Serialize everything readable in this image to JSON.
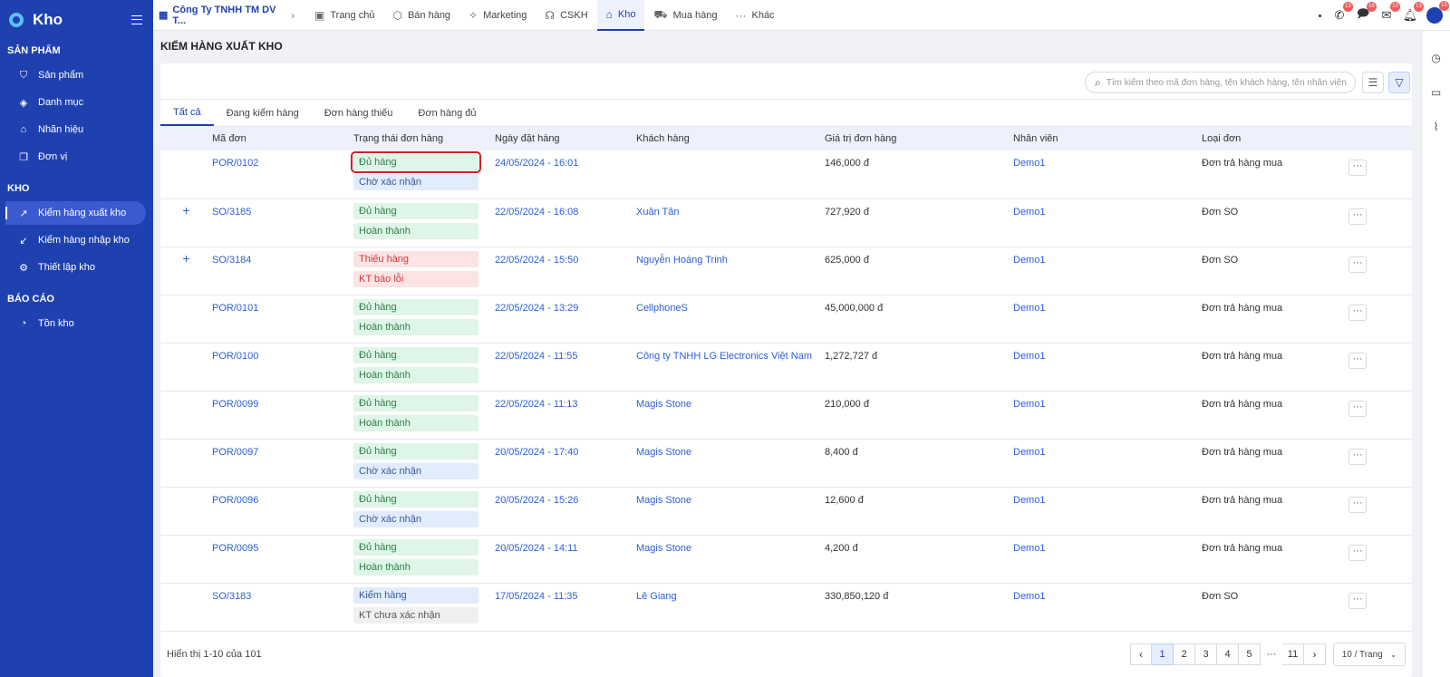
{
  "sidebar": {
    "title": "Kho",
    "sections": [
      {
        "title": "SẢN PHẨM",
        "items": [
          {
            "label": "Sản phẩm",
            "icon": "bag-icon"
          },
          {
            "label": "Danh mục",
            "icon": "layers-icon"
          },
          {
            "label": "Nhãn hiệu",
            "icon": "tag-icon"
          },
          {
            "label": "Đơn vị",
            "icon": "copy-icon"
          }
        ]
      },
      {
        "title": "KHO",
        "items": [
          {
            "label": "Kiểm hàng xuất kho",
            "icon": "arrow-up-right-icon",
            "active": true
          },
          {
            "label": "Kiểm hàng nhập kho",
            "icon": "arrow-down-left-icon"
          },
          {
            "label": "Thiết lập kho",
            "icon": "gear-icon"
          }
        ]
      },
      {
        "title": "BÁO CÁO",
        "items": [
          {
            "label": "Tồn kho",
            "icon": "pie-chart-icon"
          }
        ]
      }
    ]
  },
  "topbar": {
    "company": "Công Ty TNHH TM DV T...",
    "tabs": [
      {
        "label": "Trang chủ",
        "icon": "home-grid-icon"
      },
      {
        "label": "Bán hàng",
        "icon": "box-icon"
      },
      {
        "label": "Marketing",
        "icon": "megaphone-icon"
      },
      {
        "label": "CSKH",
        "icon": "headset-icon"
      },
      {
        "label": "Kho",
        "icon": "warehouse-icon",
        "active": true
      },
      {
        "label": "Mua hàng",
        "icon": "cart-icon"
      },
      {
        "label": "Khác",
        "icon": "more-icon"
      }
    ],
    "badges": {
      "phone": "13",
      "chat": "16",
      "mail": "10",
      "bell": "13",
      "avatar": "15"
    }
  },
  "page": {
    "title": "KIỂM HÀNG XUẤT KHO"
  },
  "search": {
    "placeholder": "Tìm kiếm theo mã đơn hàng, tên khách hàng, tên nhân viên"
  },
  "tabs": [
    "Tất cả",
    "Đang kiểm hàng",
    "Đơn hàng thiếu",
    "Đơn hàng đủ"
  ],
  "table": {
    "headers": [
      "Mã đơn",
      "Trạng thái đơn hàng",
      "Ngày đặt hàng",
      "Khách hàng",
      "Giá trị đơn hàng",
      "Nhân viên",
      "Loại đơn"
    ],
    "rows": [
      {
        "expand": "",
        "code": "POR/0102",
        "s1": "Đủ hàng",
        "c1": "green",
        "s2": "Chờ xác nhận",
        "c2": "blue",
        "date": "24/05/2024 - 16:01",
        "customer": "",
        "value": "146,000 đ",
        "staff": "Demo1",
        "type": "Đơn trả hàng mua",
        "more": "···"
      },
      {
        "expand": "+",
        "code": "SO/3185",
        "s1": "Đủ hàng",
        "c1": "green",
        "s2": "Hoàn thành",
        "c2": "green",
        "date": "22/05/2024 - 16:08",
        "customer": "Xuân Tân",
        "value": "727,920 đ",
        "staff": "Demo1",
        "type": "Đơn SO",
        "more": "···"
      },
      {
        "expand": "+",
        "code": "SO/3184",
        "s1": "Thiếu hàng",
        "c1": "red",
        "s2": "KT báo lỗi",
        "c2": "red",
        "date": "22/05/2024 - 15:50",
        "customer": "Nguyễn Hoàng Trinh",
        "value": "625,000 đ",
        "staff": "Demo1",
        "type": "Đơn SO",
        "more": "···"
      },
      {
        "expand": "",
        "code": "POR/0101",
        "s1": "Đủ hàng",
        "c1": "green",
        "s2": "Hoàn thành",
        "c2": "green",
        "date": "22/05/2024 - 13:29",
        "customer": "CellphoneS",
        "value": "45,000,000 đ",
        "staff": "Demo1",
        "type": "Đơn trả hàng mua",
        "more": "···"
      },
      {
        "expand": "",
        "code": "POR/0100",
        "s1": "Đủ hàng",
        "c1": "green",
        "s2": "Hoàn thành",
        "c2": "green",
        "date": "22/05/2024 - 11:55",
        "customer": "Công ty TNHH LG Electronics Việt Nam",
        "value": "1,272,727 đ",
        "staff": "Demo1",
        "type": "Đơn trả hàng mua",
        "more": "···"
      },
      {
        "expand": "",
        "code": "POR/0099",
        "s1": "Đủ hàng",
        "c1": "green",
        "s2": "Hoàn thành",
        "c2": "green",
        "date": "22/05/2024 - 11:13",
        "customer": "Magis Stone",
        "value": "210,000 đ",
        "staff": "Demo1",
        "type": "Đơn trả hàng mua",
        "more": "···"
      },
      {
        "expand": "",
        "code": "POR/0097",
        "s1": "Đủ hàng",
        "c1": "green",
        "s2": "Chờ xác nhận",
        "c2": "blue",
        "date": "20/05/2024 - 17:40",
        "customer": "Magis Stone",
        "value": "8,400 đ",
        "staff": "Demo1",
        "type": "Đơn trả hàng mua",
        "more": "···"
      },
      {
        "expand": "",
        "code": "POR/0096",
        "s1": "Đủ hàng",
        "c1": "green",
        "s2": "Chờ xác nhận",
        "c2": "blue",
        "date": "20/05/2024 - 15:26",
        "customer": "Magis Stone",
        "value": "12,600 đ",
        "staff": "Demo1",
        "type": "Đơn trả hàng mua",
        "more": "···"
      },
      {
        "expand": "",
        "code": "POR/0095",
        "s1": "Đủ hàng",
        "c1": "green",
        "s2": "Hoàn thành",
        "c2": "green",
        "date": "20/05/2024 - 14:11",
        "customer": "Magis Stone",
        "value": "4,200 đ",
        "staff": "Demo1",
        "type": "Đơn trả hàng mua",
        "more": "···"
      },
      {
        "expand": "",
        "code": "SO/3183",
        "s1": "Kiểm hàng",
        "c1": "blue",
        "s2": "KT chưa xác nhận",
        "c2": "gray",
        "date": "17/05/2024 - 11:35",
        "customer": "Lê Giang",
        "value": "330,850,120 đ",
        "staff": "Demo1",
        "type": "Đơn SO",
        "more": "···"
      }
    ]
  },
  "pagination": {
    "info": "Hiển thị 1-10 của 101",
    "pages": [
      "1",
      "2",
      "3",
      "4",
      "5",
      "···",
      "11"
    ],
    "current": "1",
    "page_size": "10 / Trang"
  },
  "colors": {
    "sidebar": "#1f41b0",
    "accent": "#2b5fd9",
    "highlight": "#d0202a"
  }
}
